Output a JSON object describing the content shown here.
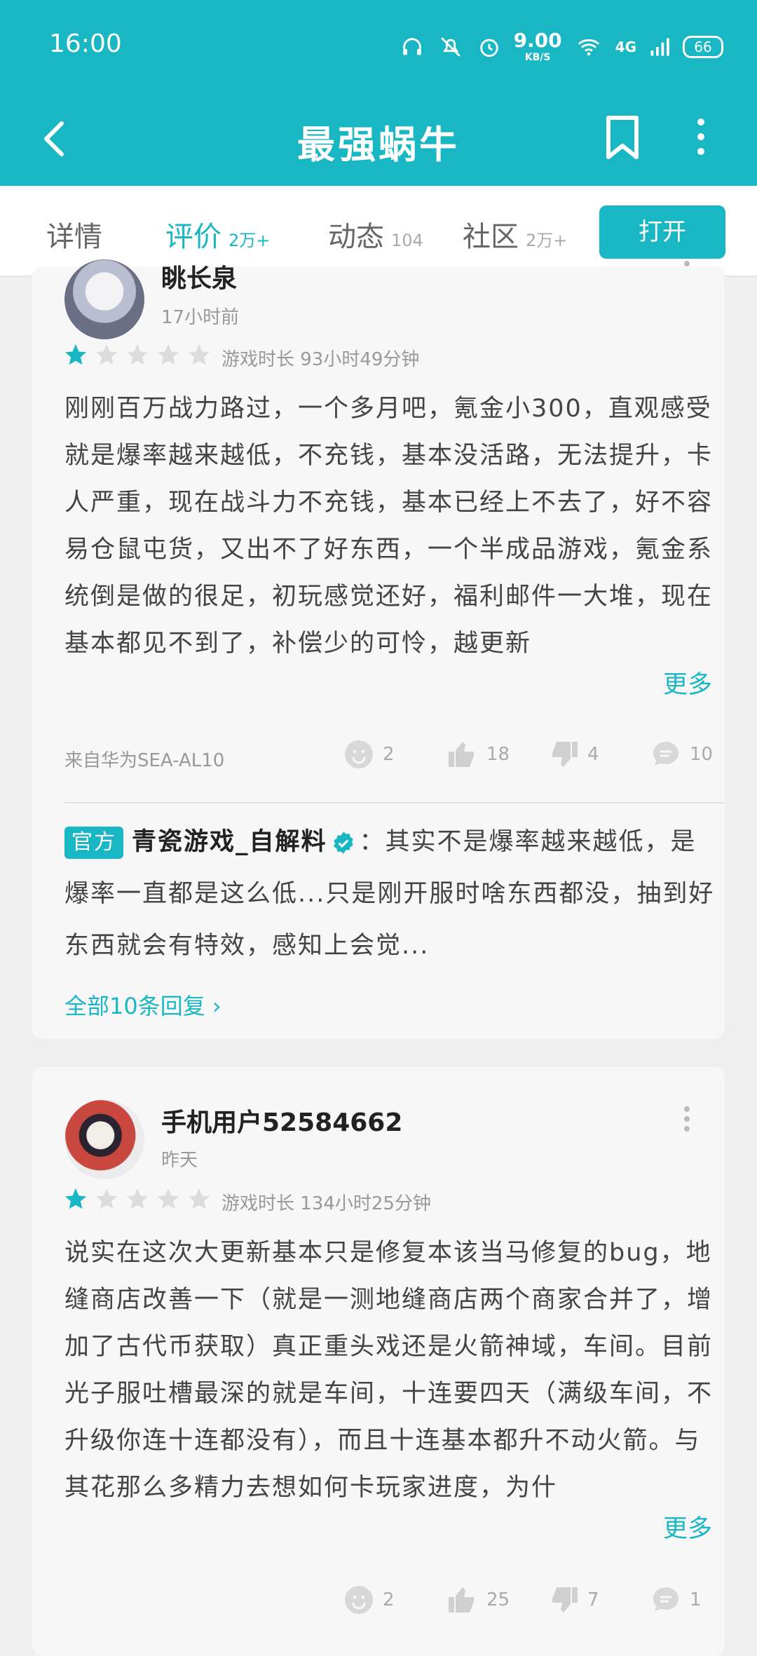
{
  "status_bar": {
    "time": "16:00",
    "speed_value": "9.00",
    "speed_unit": "KB/S",
    "network": "4G",
    "battery": "66"
  },
  "app_bar": {
    "title": "最强蜗牛"
  },
  "tabs": [
    {
      "label": "详情",
      "count": ""
    },
    {
      "label": "评价",
      "count": "2万+"
    },
    {
      "label": "动态",
      "count": "104"
    },
    {
      "label": "社区",
      "count": "2万+"
    }
  ],
  "open_button": "打开",
  "reviews": [
    {
      "username": "眺长泉",
      "time": "17小时前",
      "rating": 1,
      "playtime": "游戏时长 93小时49分钟",
      "text": "刚刚百万战力路过，一个多月吧，氪金小300，直观感受就是爆率越来越低，不充钱，基本没活路，无法提升，卡人严重，现在战斗力不充钱，基本已经上不去了，好不容易仓鼠屯货，又出不了好东西，一个半成品游戏，氪金系统倒是做的很足，初玩感觉还好，福利邮件一大堆，现在基本都见不到了，补偿少的可怜，越更新",
      "more": "更多",
      "device": "来自华为SEA-AL10",
      "reactions": {
        "funny": "2",
        "like": "18",
        "dislike": "4",
        "comments": "10"
      },
      "official_reply": {
        "badge": "官方",
        "name": "青瓷游戏_自解料",
        "text": "：其实不是爆率越来越低，是爆率一直都是这么低...只是刚开服时啥东西都没，抽到好东西就会有特效，感知上会觉...",
        "all_replies": "全部10条回复"
      }
    },
    {
      "username": "手机用户52584662",
      "time": "昨天",
      "rating": 1,
      "playtime": "游戏时长 134小时25分钟",
      "text": "说实在这次大更新基本只是修复本该当马修复的bug，地缝商店改善一下（就是一测地缝商店两个商家合并了，增加了古代币获取）真正重头戏还是火箭神域，车间。目前光子服吐槽最深的就是车间，十连要四天（满级车间，不升级你连十连都没有），而且十连基本都升不动火箭。与其花那么多精力去想如何卡玩家进度，为什",
      "more": "更多",
      "device": "",
      "reactions": {
        "funny": "2",
        "like": "25",
        "dislike": "7",
        "comments": "1"
      }
    }
  ],
  "colors": {
    "accent": "#19b7c4",
    "star_filled": "#19b7c4",
    "star_empty": "#dcdcdc"
  }
}
